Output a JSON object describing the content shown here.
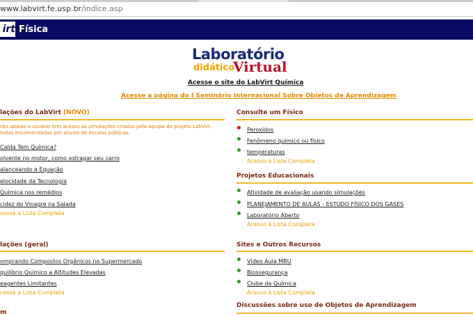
{
  "browser": {
    "url_host": "www.labvirt.fe.usp.br",
    "url_path": "/indice.asp"
  },
  "header": {
    "logo_fragment": "irt",
    "title": "Física"
  },
  "logo": {
    "line1": "Laboratório",
    "line2_small": "didático",
    "line2_big": "Virtual"
  },
  "links": {
    "quimica": "Acesse o site do LabVirt Química",
    "seminario": "Acesse a página do I Seminário Internacional Sobre Objetos de Aprendizagem"
  },
  "left": {
    "sim_labvirt": {
      "title": "lações do LabVirt",
      "accent": "(NOVO)",
      "desc_line1": "nks abaixo o usuário tem acesso às simulações criadas pela equipe do projeto LabVirt,",
      "desc_line2": "todas encomendadas por alunos de escolas públicas.",
      "items": [
        "Calda Tem Química?",
        "olvente no motor, como estragar seu carro",
        "alanceando a Equação",
        "elocidade da Tecnologia",
        "Química nos remédios",
        "cidez do Vinagre na Salada"
      ],
      "more": "cesse à Lista Completa"
    },
    "sim_geral": {
      "title": "lações (geral)",
      "items": [
        "omprando Compostos Orgânicos no Supermercado",
        "quilíbrio Químico a Altitudes Elevadas",
        "eagentes Limitantes"
      ],
      "more": "cesse à Lista Completa"
    },
    "next_section": "m"
  },
  "right": {
    "consulte": {
      "title": "Consulte um Físico",
      "items": [
        "Peroxidos",
        "Fenômeno químico ou físico",
        "temperaturas"
      ],
      "more": "Acesso à Lista Completa"
    },
    "projetos": {
      "title": "Projetos Educacionais",
      "items": [
        "Atividade de avaliação usando simulações",
        "PLANEJAMENTO DE AULAS - ESTUDO FÍSICO DOS GASES",
        "Laboratório Aberto"
      ],
      "more": "Acesso à Lista Completa"
    },
    "sites": {
      "title": "Sites e Outros Recursos",
      "items": [
        "Vídeo Aula MRU",
        "Biossegurança",
        "Clube da Química"
      ],
      "more": "Acesso à Lista Completa"
    },
    "discussoes": {
      "title": "Discussões sobre uso de Objetos de Aprendizagem"
    }
  },
  "colors": {
    "header_bg": "#0b0a63",
    "section_title": "#7a2a12",
    "accent_orange": "#e8a000",
    "rule": "#f0b72a",
    "bullet_green": "#2a9a2a",
    "bullet_red": "#ee1111"
  }
}
